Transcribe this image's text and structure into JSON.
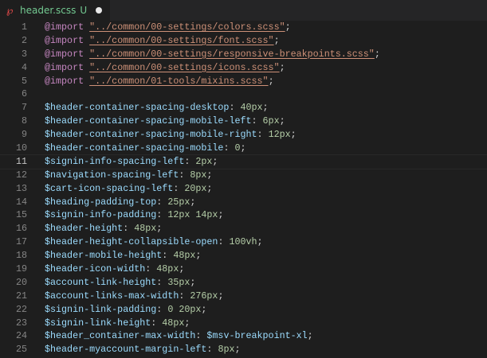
{
  "tab": {
    "filename": "header.scss",
    "status": "U",
    "icon": "sass-icon"
  },
  "current_line": 11,
  "lines": [
    [
      [
        "k",
        "@import"
      ],
      [
        "p",
        " "
      ],
      [
        "s",
        "\"../common/00-settings/colors.scss\""
      ],
      [
        "p",
        ";"
      ]
    ],
    [
      [
        "k",
        "@import"
      ],
      [
        "p",
        " "
      ],
      [
        "s",
        "\"../common/00-settings/font.scss\""
      ],
      [
        "p",
        ";"
      ]
    ],
    [
      [
        "k",
        "@import"
      ],
      [
        "p",
        " "
      ],
      [
        "s",
        "\"../common/00-settings/responsive-breakpoints.scss\""
      ],
      [
        "p",
        ";"
      ]
    ],
    [
      [
        "k",
        "@import"
      ],
      [
        "p",
        " "
      ],
      [
        "s",
        "\"../common/00-settings/icons.scss\""
      ],
      [
        "p",
        ";"
      ]
    ],
    [
      [
        "k",
        "@import"
      ],
      [
        "p",
        " "
      ],
      [
        "s",
        "\"../common/01-tools/mixins.scss\""
      ],
      [
        "p",
        ";"
      ]
    ],
    [],
    [
      [
        "v",
        "$header-container-spacing-desktop"
      ],
      [
        "p",
        ": "
      ],
      [
        "n",
        "40px"
      ],
      [
        "p",
        ";"
      ]
    ],
    [
      [
        "v",
        "$header-container-spacing-mobile-left"
      ],
      [
        "p",
        ": "
      ],
      [
        "n",
        "6px"
      ],
      [
        "p",
        ";"
      ]
    ],
    [
      [
        "v",
        "$header-container-spacing-mobile-right"
      ],
      [
        "p",
        ": "
      ],
      [
        "n",
        "12px"
      ],
      [
        "p",
        ";"
      ]
    ],
    [
      [
        "v",
        "$header-container-spacing-mobile"
      ],
      [
        "p",
        ": "
      ],
      [
        "n",
        "0"
      ],
      [
        "p",
        ";"
      ]
    ],
    [
      [
        "v",
        "$signin-info-spacing-left"
      ],
      [
        "p",
        ": "
      ],
      [
        "n",
        "2px"
      ],
      [
        "p",
        ";"
      ]
    ],
    [
      [
        "v",
        "$navigation-spacing-left"
      ],
      [
        "p",
        ": "
      ],
      [
        "n",
        "8px"
      ],
      [
        "p",
        ";"
      ]
    ],
    [
      [
        "v",
        "$cart-icon-spacing-left"
      ],
      [
        "p",
        ": "
      ],
      [
        "n",
        "20px"
      ],
      [
        "p",
        ";"
      ]
    ],
    [
      [
        "v",
        "$heading-padding-top"
      ],
      [
        "p",
        ": "
      ],
      [
        "n",
        "25px"
      ],
      [
        "p",
        ";"
      ]
    ],
    [
      [
        "v",
        "$signin-info-padding"
      ],
      [
        "p",
        ": "
      ],
      [
        "n",
        "12px"
      ],
      [
        "p",
        " "
      ],
      [
        "n",
        "14px"
      ],
      [
        "p",
        ";"
      ]
    ],
    [
      [
        "v",
        "$header-height"
      ],
      [
        "p",
        ": "
      ],
      [
        "n",
        "48px"
      ],
      [
        "p",
        ";"
      ]
    ],
    [
      [
        "v",
        "$header-height-collapsible-open"
      ],
      [
        "p",
        ": "
      ],
      [
        "n",
        "100vh"
      ],
      [
        "p",
        ";"
      ]
    ],
    [
      [
        "v",
        "$header-mobile-height"
      ],
      [
        "p",
        ": "
      ],
      [
        "n",
        "48px"
      ],
      [
        "p",
        ";"
      ]
    ],
    [
      [
        "v",
        "$header-icon-width"
      ],
      [
        "p",
        ": "
      ],
      [
        "n",
        "48px"
      ],
      [
        "p",
        ";"
      ]
    ],
    [
      [
        "v",
        "$account-link-height"
      ],
      [
        "p",
        ": "
      ],
      [
        "n",
        "35px"
      ],
      [
        "p",
        ";"
      ]
    ],
    [
      [
        "v",
        "$account-links-max-width"
      ],
      [
        "p",
        ": "
      ],
      [
        "n",
        "276px"
      ],
      [
        "p",
        ";"
      ]
    ],
    [
      [
        "v",
        "$signin-link-padding"
      ],
      [
        "p",
        ": "
      ],
      [
        "n",
        "0"
      ],
      [
        "p",
        " "
      ],
      [
        "n",
        "20px"
      ],
      [
        "p",
        ";"
      ]
    ],
    [
      [
        "v",
        "$signin-link-height"
      ],
      [
        "p",
        ": "
      ],
      [
        "n",
        "48px"
      ],
      [
        "p",
        ";"
      ]
    ],
    [
      [
        "v",
        "$header_container-max-width"
      ],
      [
        "p",
        ": "
      ],
      [
        "v",
        "$msv-breakpoint-xl"
      ],
      [
        "p",
        ";"
      ]
    ],
    [
      [
        "v",
        "$header-myaccount-margin-left"
      ],
      [
        "p",
        ": "
      ],
      [
        "n",
        "8px"
      ],
      [
        "p",
        ";"
      ]
    ]
  ]
}
